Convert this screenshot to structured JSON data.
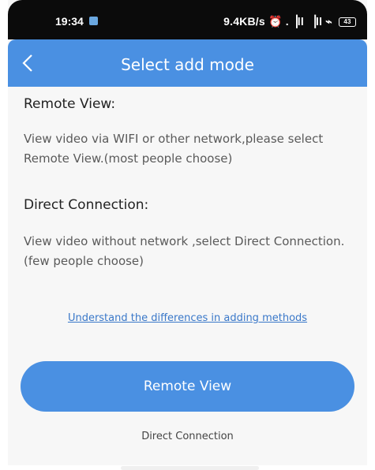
{
  "status_bar": {
    "time": "19:34",
    "network_speed": "9.4KB/s",
    "signal_icons": "⏰ .▕ll ▕ll ⌁",
    "battery": "43"
  },
  "header": {
    "back_icon": "chevron-left-icon",
    "title": "Select add mode"
  },
  "sections": [
    {
      "title": "Remote View:",
      "description": "View video via WIFI or other network,please select Remote View.(most people choose)"
    },
    {
      "title": "Direct Connection:",
      "description": "View video without network ,select Direct Connection.(few people choose)"
    }
  ],
  "link": {
    "label": "Understand the differences in adding methods"
  },
  "buttons": {
    "primary_label": "Remote View",
    "secondary_label": "Direct Connection"
  },
  "colors": {
    "accent": "#4a90e2",
    "link": "#3a78c9",
    "background": "#f7f7f7"
  }
}
